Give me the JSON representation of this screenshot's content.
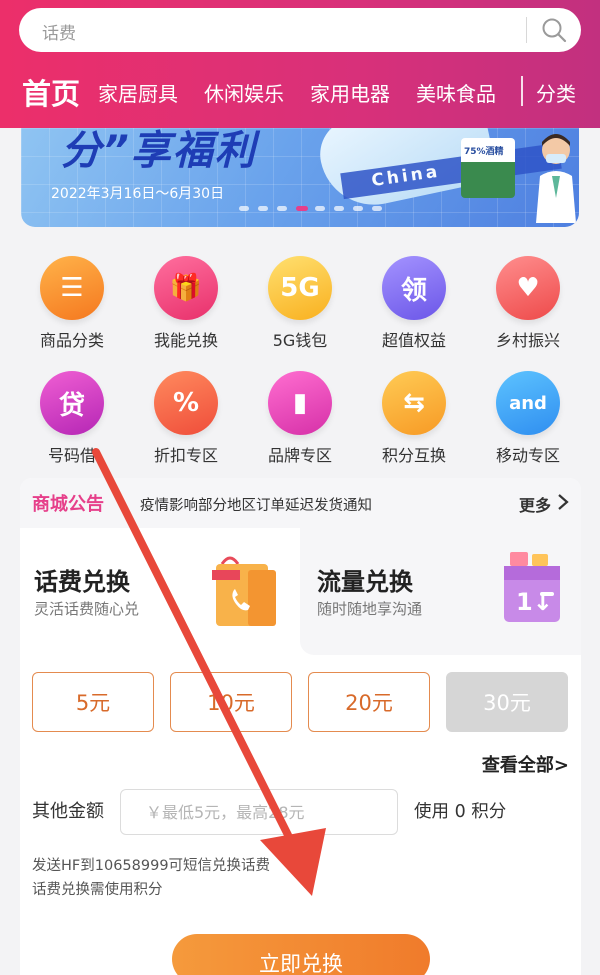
{
  "search": {
    "placeholder": "话费"
  },
  "nav": {
    "home": "首页",
    "items": [
      "家居厨具",
      "休闲娱乐",
      "家用电器",
      "美味食品"
    ],
    "category": "分类"
  },
  "banner": {
    "title": "分”享福利",
    "date": "2022年3月16日～6月30日",
    "tag_text": "China",
    "box_text": "75%酒精",
    "page_count": 8,
    "active_index": 3
  },
  "grid": {
    "items": [
      {
        "label": "商品分类",
        "icon": "list-icon",
        "glyph": "☰",
        "color1": "#ffb34a",
        "color2": "#f5781f"
      },
      {
        "label": "我能兑换",
        "icon": "gift-icon",
        "glyph": "🎁",
        "color1": "#ff6f9e",
        "color2": "#e8306b"
      },
      {
        "label": "5G钱包",
        "icon": "5g-wallet-icon",
        "glyph": "5G",
        "color1": "#ffe070",
        "color2": "#f9b01f"
      },
      {
        "label": "超值权益",
        "icon": "coupon-icon",
        "glyph": "领",
        "color1": "#a493ff",
        "color2": "#6b56e8"
      },
      {
        "label": "乡村振兴",
        "icon": "heart-hand-icon",
        "glyph": "♥",
        "color1": "#ff8e8e",
        "color2": "#ee4a4a"
      },
      {
        "label": "号码借",
        "icon": "loan-icon",
        "glyph": "贷",
        "color1": "#f05fd3",
        "color2": "#b526b5"
      },
      {
        "label": "折扣专区",
        "icon": "discount-icon",
        "glyph": "%",
        "color1": "#ff8a5e",
        "color2": "#ef4d3a"
      },
      {
        "label": "品牌专区",
        "icon": "brand-icon",
        "glyph": "▮",
        "color1": "#ff6ed0",
        "color2": "#d630a8"
      },
      {
        "label": "积分互换",
        "icon": "exchange-icon",
        "glyph": "⇆",
        "color1": "#ffcb55",
        "color2": "#f79a25"
      },
      {
        "label": "移动专区",
        "icon": "mobile-zone-icon",
        "glyph": "and",
        "color1": "#5dc3ff",
        "color2": "#2f8ef0"
      }
    ]
  },
  "notice": {
    "tag": "商城公告",
    "text": "疫情影响部分地区订单延迟发货通知",
    "more": "更多"
  },
  "tabs": {
    "active": {
      "title": "话费兑换",
      "sub": "灵活话费随心兑"
    },
    "inactive": {
      "title": "流量兑换",
      "sub": "随时随地享沟通"
    }
  },
  "amounts": [
    "5元",
    "10元",
    "20元",
    "30元"
  ],
  "view_all": "查看全部>",
  "other": {
    "label": "其他金额",
    "placeholder": "￥最低5元，最高28元",
    "use_points": "使用 0 积分"
  },
  "hints": [
    "发送HF到10658999可短信兑换话费",
    "话费兑换需使用积分"
  ],
  "submit": "立即兑换",
  "colors": {
    "brand": "#e63f8a",
    "accent": "#f07b2b",
    "annotation": "#e8483a"
  }
}
